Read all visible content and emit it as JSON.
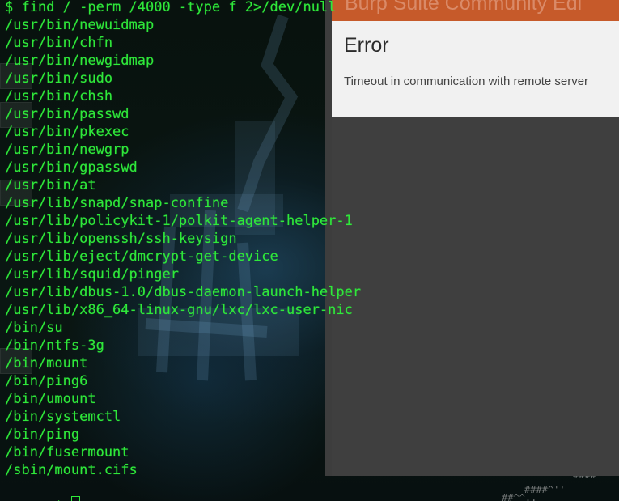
{
  "terminal": {
    "command_line": "$ find / -perm /4000 -type f 2>/dev/null",
    "output_lines": [
      "/usr/bin/newuidmap",
      "/usr/bin/chfn",
      "/usr/bin/newgidmap",
      "/usr/bin/sudo",
      "/usr/bin/chsh",
      "/usr/bin/passwd",
      "/usr/bin/pkexec",
      "/usr/bin/newgrp",
      "/usr/bin/gpasswd",
      "/usr/bin/at",
      "/usr/lib/snapd/snap-confine",
      "/usr/lib/policykit-1/polkit-agent-helper-1",
      "/usr/lib/openssh/ssh-keysign",
      "/usr/lib/eject/dmcrypt-get-device",
      "/usr/lib/squid/pinger",
      "/usr/lib/dbus-1.0/dbus-daemon-launch-helper",
      "/usr/lib/x86_64-linux-gnu/lxc/lxc-user-nic",
      "/bin/su",
      "/bin/ntfs-3g",
      "/bin/mount",
      "/bin/ping6",
      "/bin/umount",
      "/bin/systemctl",
      "/bin/ping",
      "/bin/fusermount",
      "/sbin/mount.cifs"
    ],
    "prompt": "$",
    "text_color": "#2fe83a"
  },
  "burp_dialog": {
    "window_title": "Burp Suite Community Edi",
    "error_heading": "Error",
    "error_message": "Timeout in communication with remote server",
    "title_color": "#c65a2a"
  },
  "wallpaper": {
    "ascii_a": "'''''..",
    "ascii_b": "########",
    "ascii_c": "##",
    "ascii_d": "####",
    "ascii_e": "##^^..",
    "ascii_f": "####^''"
  }
}
